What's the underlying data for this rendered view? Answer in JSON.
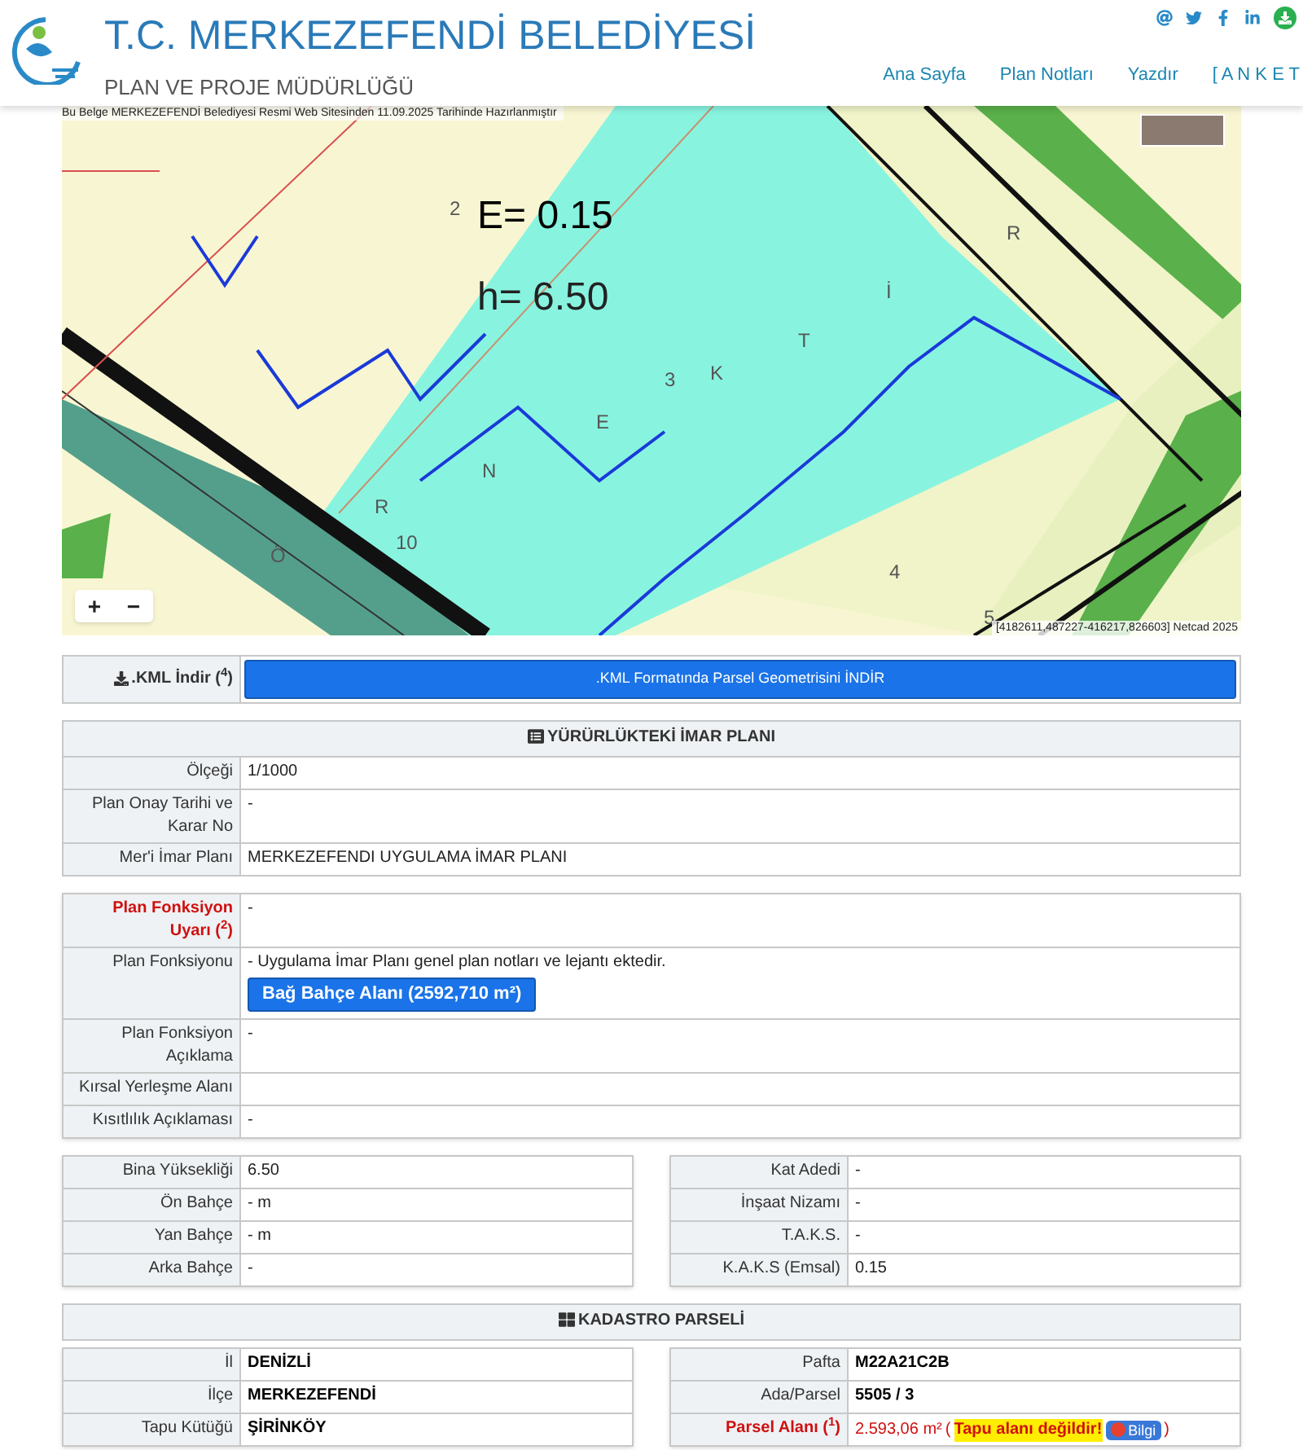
{
  "header": {
    "title": "T.C. MERKEZEFENDİ BELEDİYESİ",
    "subtitle": "PLAN VE PROJE MÜDÜRLÜĞÜ",
    "nav": [
      {
        "label": "Ana Sayfa"
      },
      {
        "label": "Plan Notları"
      },
      {
        "label": "Yazdır"
      },
      {
        "label": "[ A N K E T"
      }
    ]
  },
  "map": {
    "notice": "Bu Belge MERKEZEFENDİ Belediyesi Resmi Web Sitesinden 11.09.2025 Tarihinde Hazırlanmıştır",
    "e_label": "E= 0.15",
    "h_label": "h= 6.50",
    "labels": [
      "2",
      "3",
      "4",
      "N",
      "E",
      "K",
      "T",
      "İ",
      "R",
      "R",
      "10",
      "5",
      "Ö"
    ],
    "zoom": [
      "+",
      "−"
    ],
    "attribution": "[4182611,487227-416217,826603] Netcad 2025"
  },
  "kml": {
    "label": ".KML İndir ($^{4}$)",
    "button": ".KML Formatında Parsel Geometrisini İNDİR"
  },
  "imar": {
    "title": "YÜRÜRLÜKTEKİ İMAR PLANI",
    "rows": [
      {
        "label": "Ölçeği",
        "value": "1/1000"
      },
      {
        "label": "Plan Onay Tarihi ve Karar No",
        "value": "-"
      },
      {
        "label": "Mer'i İmar Planı",
        "value": "MERKEZEFENDI UYGULAMA İMAR PLANI"
      }
    ]
  },
  "fonksiyon": {
    "rows": [
      {
        "kind": "warning",
        "label": "Plan Fonksiyon Uyarı ($^{2}$)",
        "value": "-"
      },
      {
        "kind": "function",
        "label": "Plan Fonksiyonu",
        "value": "- Uygulama İmar Planı genel plan notları ve lejantı ektedir.",
        "button": "Bağ Bahçe Alanı (2592,710 m²)"
      },
      {
        "kind": "text",
        "label": "Plan Fonksiyon Açıklama",
        "value": "-"
      },
      {
        "kind": "text",
        "label": "Kırsal Yerleşme Alanı"
      },
      {
        "kind": "text",
        "label": "Kısıtlılık Açıklaması",
        "value": "-"
      }
    ]
  },
  "building": {
    "left": [
      {
        "kind": "text",
        "label": "Bina Yüksekliği",
        "value": "6.50"
      },
      {
        "kind": "text",
        "label": "Ön Bahçe",
        "value": "- m"
      },
      {
        "kind": "text",
        "label": "Yan Bahçe",
        "value": "- m"
      },
      {
        "kind": "text",
        "label": "Arka Bahçe",
        "value": "-"
      }
    ],
    "right": [
      {
        "kind": "text",
        "label": "Kat Adedi",
        "value": "-"
      },
      {
        "kind": "text",
        "label": "İnşaat Nizamı",
        "value": "-"
      },
      {
        "kind": "text",
        "label": "T.A.K.S.",
        "value": "-"
      },
      {
        "kind": "text",
        "label": "K.A.K.S (Emsal)",
        "value": "0.15"
      }
    ]
  },
  "kadastro": {
    "title": "KADASTRO PARSELİ",
    "left": [
      {
        "kind": "text",
        "label": "İl",
        "value": "DENİZLİ"
      },
      {
        "kind": "text",
        "label": "İlçe",
        "value": "MERKEZEFENDİ"
      },
      {
        "kind": "text",
        "label": "Tapu Kütüğü",
        "value": "ŞİRİNKÖY"
      }
    ],
    "right": [
      {
        "kind": "text",
        "label": "Pafta",
        "value": "M22A21C2B"
      },
      {
        "kind": "text",
        "label": "Ada/Parsel",
        "value": "5505 / 3"
      },
      {
        "kind": "area",
        "label": "Parsel Alanı ($^{1}$)",
        "value": "2.593,06 m²",
        "open": "(",
        "note": "Tapu alanı değildir!",
        "badge": "Bilgi",
        "close": ")"
      }
    ]
  }
}
